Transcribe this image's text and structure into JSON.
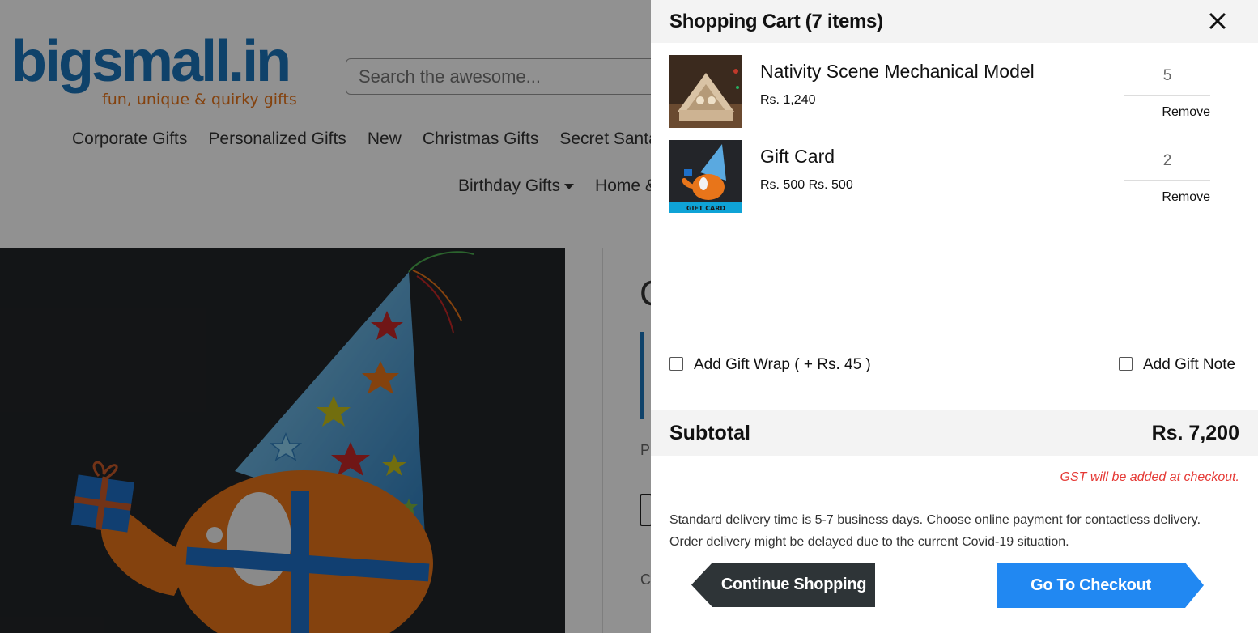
{
  "background": {
    "logo": {
      "name": "bigsmall.in",
      "tagline": "fun, unique & quirky gifts"
    },
    "search": {
      "placeholder": "Search the awesome..."
    },
    "nav_row1": [
      "Corporate Gifts",
      "Personalized Gifts",
      "New",
      "Christmas Gifts",
      "Secret Santa"
    ],
    "nav_row2": [
      "Birthday Gifts",
      "Home &"
    ],
    "product_partial": {
      "title_letter": "C",
      "label_p": "P",
      "label_c": "C"
    }
  },
  "cart": {
    "title": "Shopping Cart (7 items)",
    "items": [
      {
        "name": "Nativity Scene Mechanical Model",
        "price": "Rs. 1,240",
        "qty": "5",
        "remove": "Remove"
      },
      {
        "name": "Gift Card",
        "price": "Rs. 500 Rs. 500",
        "qty": "2",
        "remove": "Remove",
        "thumb_caption": "GIFT CARD"
      }
    ],
    "gift_wrap_label": "Add Gift Wrap ( + Rs. 45 )",
    "gift_note_label": "Add Gift Note",
    "subtotal_label": "Subtotal",
    "subtotal_value": "Rs. 7,200",
    "gst_note": "GST will be added at checkout.",
    "delivery_note": [
      "Standard delivery time is 5-7 business days. Choose online payment for contactless delivery.",
      "Order delivery might be delayed due to the current Covid-19 situation."
    ],
    "continue_label": "Continue Shopping",
    "checkout_label": "Go To Checkout"
  },
  "colors": {
    "brand_blue": "#1b75bb",
    "brand_orange": "#e8751a",
    "checkout_blue": "#2188f2",
    "continue_dark": "#2e3437",
    "gst_red": "#e53935"
  }
}
